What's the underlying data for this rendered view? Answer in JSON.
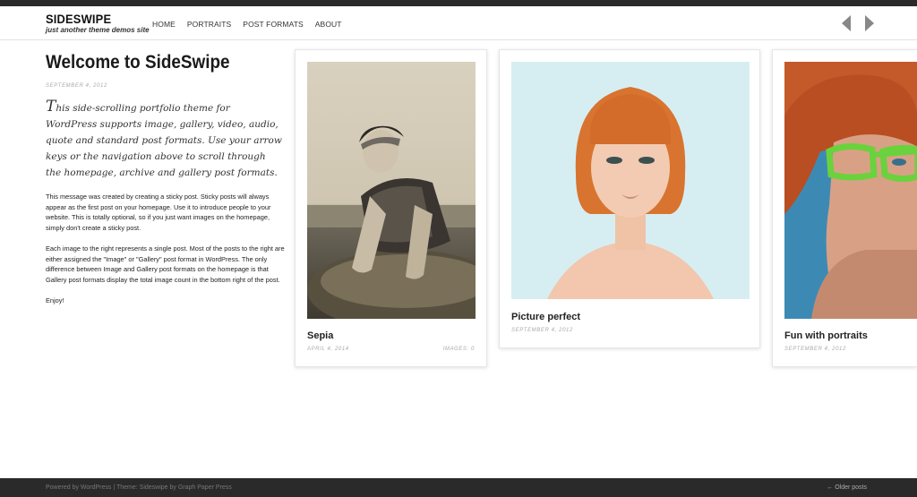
{
  "site": {
    "title": "SIDESWIPE",
    "tagline": "just another theme demos site"
  },
  "nav": {
    "items": [
      "HOME",
      "PORTRAITS",
      "POST FORMATS",
      "ABOUT"
    ]
  },
  "pager_arrows": {
    "prev_icon": "triangle-left-icon",
    "next_icon": "triangle-right-icon",
    "color": "#888888"
  },
  "intro": {
    "title": "Welcome to SideSwipe",
    "date": "SEPTEMBER 4, 2012",
    "lead_initial": "T",
    "lead_rest": "his side-scrolling portfolio theme for WordPress supports image, gallery, video, audio, quote and standard post formats. Use your arrow keys or the navigation above to scroll through the homepage, archive and gallery post formats.",
    "paragraphs": [
      "This message was created by creating a sticky post. Sticky posts will always appear as the first post on your homepage. Use it to introduce people to your website. This is totally optional, so if you just want images on the homepage, simply don't create a sticky post.",
      "Each image to the right represents a single post. Most of the posts to the right are either assigned the \"Image\" or \"Gallery\" post format in WordPress. The only difference between Image and Gallery post formats on the homepage is that Gallery post formats display the total image count in the bottom right of the post.",
      "Enjoy!"
    ]
  },
  "posts": [
    {
      "title": "Sepia",
      "date": "APRIL 4, 2014",
      "count": "IMAGES: 0"
    },
    {
      "title": "Picture perfect",
      "date": "SEPTEMBER 4, 2012"
    },
    {
      "title": "Fun with portraits",
      "date": "SEPTEMBER 4, 2012"
    }
  ],
  "footer": {
    "credit": "Powered by WordPress | Theme: Sideswipe by Graph Paper Press",
    "older": "← Older posts"
  },
  "colors": {
    "topbar": "#2a2a2a",
    "footer": "#2a2a2a",
    "card_border": "#e6e6e6"
  }
}
